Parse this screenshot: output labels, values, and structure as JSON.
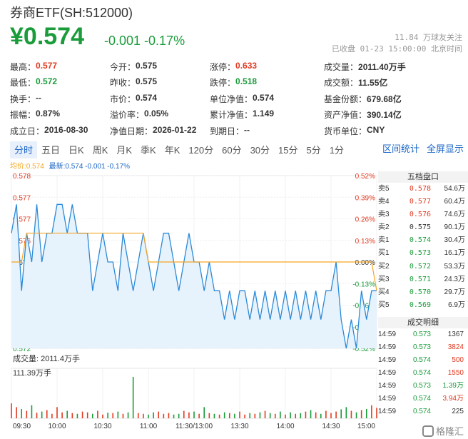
{
  "header": {
    "title": "券商ETF(SH:512000)",
    "price": "¥0.574",
    "change": "-0.001 -0.17%",
    "followers": "11.84 万球友关注",
    "status": "已收盘 01-23 15:00:00 北京时间"
  },
  "stats": [
    [
      {
        "k": "最高：",
        "v": "0.577",
        "c": "red"
      },
      {
        "k": "今开：",
        "v": "0.575",
        "c": ""
      },
      {
        "k": "涨停：",
        "v": "0.633",
        "c": "red"
      },
      {
        "k": "成交量：",
        "v": "2011.40万手",
        "c": ""
      }
    ],
    [
      {
        "k": "最低：",
        "v": "0.572",
        "c": "green"
      },
      {
        "k": "昨收：",
        "v": "0.575",
        "c": ""
      },
      {
        "k": "跌停：",
        "v": "0.518",
        "c": "green"
      },
      {
        "k": "成交额：",
        "v": "11.55亿",
        "c": ""
      }
    ],
    [
      {
        "k": "换手：",
        "v": "--",
        "c": ""
      },
      {
        "k": "市价：",
        "v": "0.574",
        "c": ""
      },
      {
        "k": "单位净值：",
        "v": "0.574",
        "c": ""
      },
      {
        "k": "基金份额：",
        "v": "679.68亿",
        "c": ""
      }
    ],
    [
      {
        "k": "振幅：",
        "v": "0.87%",
        "c": ""
      },
      {
        "k": "溢价率：",
        "v": "0.05%",
        "c": ""
      },
      {
        "k": "累计净值：",
        "v": "1.149",
        "c": ""
      },
      {
        "k": "资产净值：",
        "v": "390.14亿",
        "c": ""
      }
    ],
    [
      {
        "k": "成立日：",
        "v": "2016-08-30",
        "c": ""
      },
      {
        "k": "净值日期：",
        "v": "2026-01-22",
        "c": ""
      },
      {
        "k": "到期日：",
        "v": "--",
        "c": ""
      },
      {
        "k": "货币单位：",
        "v": "CNY",
        "c": ""
      }
    ]
  ],
  "tabs": [
    "分时",
    "五日",
    "日K",
    "周K",
    "月K",
    "季K",
    "年K",
    "120分",
    "60分",
    "30分",
    "15分",
    "5分",
    "1分"
  ],
  "right_tabs": [
    "区间统计",
    "全屏显示"
  ],
  "legend": {
    "avg": "均价:0.574",
    "latest": "最新:0.574 -0.001 -0.17%"
  },
  "volume": {
    "label": "成交量: 2011.4万手",
    "max": "111.39万手"
  },
  "orderbook": {
    "title": "五档盘口",
    "asks": [
      [
        "卖5",
        "0.578",
        "54.6万"
      ],
      [
        "卖4",
        "0.577",
        "60.4万"
      ],
      [
        "卖3",
        "0.576",
        "74.6万"
      ],
      [
        "卖2",
        "0.575",
        "90.1万"
      ],
      [
        "卖1",
        "0.574",
        "30.4万"
      ]
    ],
    "bids": [
      [
        "买1",
        "0.573",
        "16.1万"
      ],
      [
        "买2",
        "0.572",
        "53.3万"
      ],
      [
        "买3",
        "0.571",
        "24.3万"
      ],
      [
        "买4",
        "0.570",
        "29.7万"
      ],
      [
        "买5",
        "0.569",
        "6.9万"
      ]
    ]
  },
  "trades": {
    "title": "成交明细",
    "rows": [
      [
        "14:59",
        "0.573",
        "1367",
        ""
      ],
      [
        "14:59",
        "0.573",
        "3824",
        "red"
      ],
      [
        "14:59",
        "0.574",
        "500",
        "red"
      ],
      [
        "14:59",
        "0.574",
        "1550",
        "red"
      ],
      [
        "14:59",
        "0.573",
        "1.39万",
        "green"
      ],
      [
        "14:59",
        "0.574",
        "3.94万",
        "red"
      ],
      [
        "14:59",
        "0.574",
        "225",
        ""
      ]
    ]
  },
  "watermark": "格隆汇",
  "colors": {
    "up": "#e23b22",
    "down": "#1a9c3a",
    "line": "#2b8ad8",
    "avg": "#f5a623",
    "accent": "#1c66c6"
  },
  "chart_data": {
    "type": "line",
    "y_left_ticks": [
      "0.578",
      "0.577",
      "0.577",
      "0.576",
      "0.575",
      "0.574",
      "0.573",
      "0.573",
      "0.572"
    ],
    "y_right_ticks": [
      "0.52%",
      "0.39%",
      "0.26%",
      "0.13%",
      "0.00%",
      "-0.13%",
      "-0.26%",
      "-0.39%",
      "-0.52%"
    ],
    "x_ticks": [
      "09:30",
      "10:00",
      "10:30",
      "11:00",
      "11:30/13:00",
      "13:30",
      "14:00",
      "14:30",
      "15:00"
    ],
    "ylim": [
      0.572,
      0.578
    ],
    "prev_close": 0.575,
    "price": [
      0.576,
      0.577,
      0.574,
      0.576,
      0.575,
      0.577,
      0.575,
      0.576,
      0.576,
      0.577,
      0.577,
      0.576,
      0.577,
      0.576,
      0.576,
      0.576,
      0.574,
      0.575,
      0.576,
      0.575,
      0.575,
      0.574,
      0.576,
      0.575,
      0.574,
      0.575,
      0.576,
      0.575,
      0.574,
      0.575,
      0.576,
      0.576,
      0.575,
      0.574,
      0.575,
      0.576,
      0.575,
      0.575,
      0.574,
      0.575,
      0.574,
      0.574,
      0.573,
      0.574,
      0.573,
      0.574,
      0.574,
      0.573,
      0.574,
      0.573,
      0.574,
      0.573,
      0.574,
      0.573,
      0.574,
      0.573,
      0.574,
      0.573,
      0.574,
      0.573,
      0.574,
      0.573,
      0.574,
      0.574,
      0.575,
      0.573,
      0.572,
      0.573,
      0.572,
      0.574,
      0.573,
      0.574,
      0.574
    ],
    "avg": [
      0.575,
      0.575,
      0.575,
      0.576,
      0.576,
      0.576,
      0.576,
      0.576,
      0.576,
      0.576,
      0.576,
      0.576,
      0.576,
      0.576,
      0.576,
      0.576,
      0.576,
      0.576,
      0.576,
      0.576,
      0.576,
      0.576,
      0.576,
      0.576,
      0.576,
      0.576,
      0.576,
      0.575,
      0.575,
      0.575,
      0.575,
      0.575,
      0.575,
      0.575,
      0.575,
      0.575,
      0.575,
      0.575,
      0.575,
      0.575,
      0.575,
      0.575,
      0.575,
      0.575,
      0.575,
      0.575,
      0.575,
      0.575,
      0.575,
      0.575,
      0.575,
      0.575,
      0.575,
      0.575,
      0.575,
      0.575,
      0.575,
      0.575,
      0.575,
      0.575,
      0.575,
      0.575,
      0.575,
      0.575,
      0.575,
      0.575,
      0.575,
      0.575,
      0.575,
      0.575,
      0.575,
      0.575,
      0.574
    ],
    "volume": [
      40,
      30,
      25,
      20,
      35,
      15,
      18,
      22,
      12,
      30,
      16,
      20,
      14,
      12,
      18,
      16,
      12,
      20,
      10,
      15,
      14,
      18,
      12,
      16,
      111,
      14,
      12,
      10,
      16,
      18,
      12,
      14,
      10,
      12,
      20,
      16,
      18,
      12,
      30,
      14,
      12,
      10,
      16,
      14,
      12,
      18,
      10,
      14,
      12,
      16,
      20,
      14,
      12,
      18,
      10,
      16,
      12,
      14,
      18,
      22,
      16,
      12,
      20,
      14,
      18,
      24,
      30,
      20,
      16,
      22,
      25,
      35,
      28
    ]
  }
}
